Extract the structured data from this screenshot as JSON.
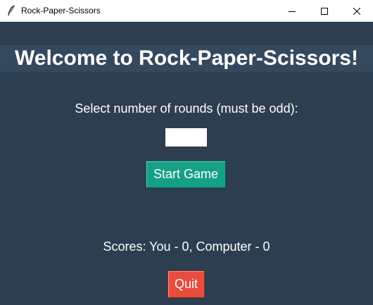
{
  "window": {
    "title": "Rock-Paper-Scissors",
    "icon": "feather-icon",
    "controls": [
      "minimize-icon",
      "maximize-icon",
      "close-icon"
    ]
  },
  "main": {
    "heading": "Welcome to Rock-Paper-Scissors!",
    "rounds_prompt": "Select number of rounds (must be odd):",
    "rounds_input_value": "",
    "start_button_label": "Start Game",
    "scores_text": "Scores: You - 0, Computer - 0",
    "quit_button_label": "Quit"
  },
  "colors": {
    "background": "#2c3e50",
    "heading_band": "#34495e",
    "start_button": "#16a085",
    "quit_button": "#e74c3c",
    "text": "#ffffff"
  }
}
